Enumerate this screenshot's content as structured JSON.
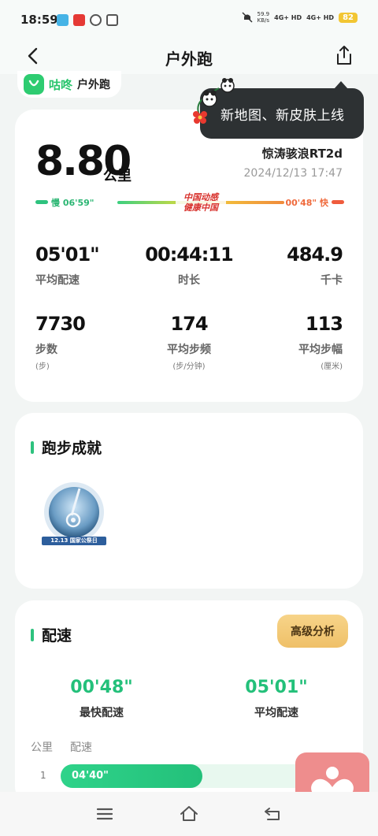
{
  "status_bar": {
    "time": "18:59",
    "net_speed": "59.9",
    "net_unit": "KB/s",
    "signal_1": "4G+ HD",
    "signal_2": "4G+ HD",
    "battery": "82"
  },
  "header": {
    "title": "户外跑",
    "back_icon": "back-arrow-icon",
    "share_icon": "share-icon"
  },
  "brand": {
    "name": "咕咚",
    "sub": "户外跑"
  },
  "tooltip": {
    "text": "新地图、新皮肤上线"
  },
  "summary": {
    "distance": "8.80",
    "distance_unit": "公里",
    "device": "惊涛骇浪RT2d",
    "datetime": "2024/12/13 17:47",
    "slow_label": "慢 06'59\"",
    "fast_label": "00'48\" 快",
    "slogan_line1": "中国动感",
    "slogan_line2": "健康中国"
  },
  "metrics": [
    {
      "value": "05'01\"",
      "label": "平均配速",
      "unit": ""
    },
    {
      "value": "00:44:11",
      "label": "时长",
      "unit": ""
    },
    {
      "value": "484.9",
      "label": "千卡",
      "unit": ""
    },
    {
      "value": "7730",
      "label": "步数",
      "unit": "(步)"
    },
    {
      "value": "174",
      "label": "平均步频",
      "unit": "(步/分钟)"
    },
    {
      "value": "113",
      "label": "平均步幅",
      "unit": "(厘米)"
    }
  ],
  "achievements": {
    "title": "跑步成就",
    "medal_caption": "12.13 国家公祭日"
  },
  "pace": {
    "title": "配速",
    "advanced_button": "高级分析",
    "fastest_value": "00'48\"",
    "fastest_label": "最快配速",
    "average_value": "05'01\"",
    "average_label": "平均配速",
    "col_km": "公里",
    "col_pace": "配速",
    "rows": [
      {
        "km": "1",
        "pace": "04'40\"",
        "fill_fraction": 0.5
      }
    ]
  },
  "colors": {
    "accent_green": "#23c07a",
    "accent_orange": "#ef6a3c",
    "button_gold": "#f7d489",
    "fab_pink": "#ee8d8d"
  },
  "bottom_nav": {
    "icons": [
      "menu-icon",
      "home-icon",
      "back-icon"
    ]
  }
}
